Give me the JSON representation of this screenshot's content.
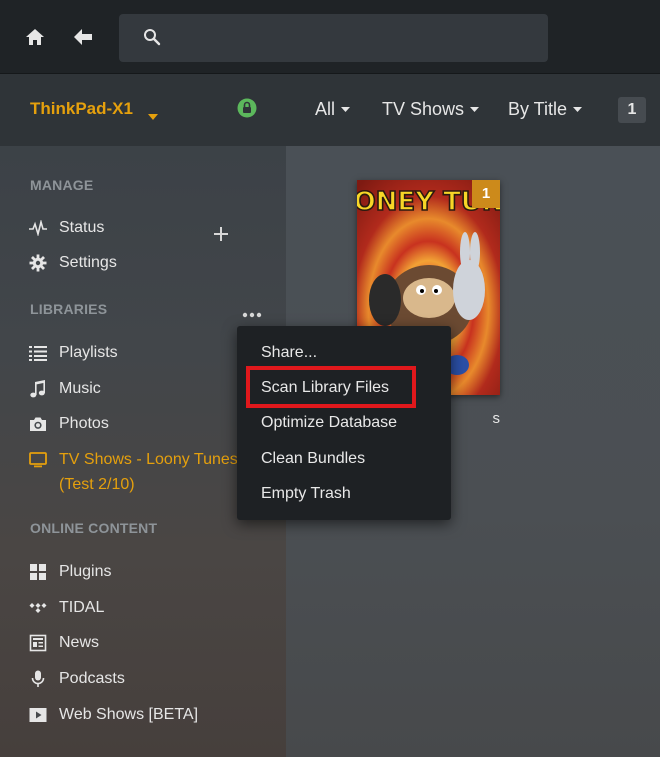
{
  "topbar": {
    "search_placeholder": ""
  },
  "server": {
    "name": "ThinkPad-X1",
    "accent_color": "#e5a00d",
    "lock_color": "#5cb85c"
  },
  "sidebar": {
    "manage_title": "MANAGE",
    "manage_items": [
      {
        "label": "Status",
        "icon": "pulse-icon"
      },
      {
        "label": "Settings",
        "icon": "gear-icon"
      }
    ],
    "libraries_title": "LIBRARIES",
    "library_items": [
      {
        "label": "Playlists",
        "icon": "list-icon"
      },
      {
        "label": "Music",
        "icon": "music-note-icon"
      },
      {
        "label": "Photos",
        "icon": "camera-icon"
      },
      {
        "label": "TV Shows - Loony Tunes",
        "sublabel": "(Test 2/10)",
        "icon": "tv-icon",
        "active": true
      }
    ],
    "online_title": "ONLINE CONTENT",
    "online_items": [
      {
        "label": "Plugins",
        "icon": "grid-icon"
      },
      {
        "label": "TIDAL",
        "icon": "tidal-icon"
      },
      {
        "label": "News",
        "icon": "newspaper-icon"
      },
      {
        "label": "Podcasts",
        "icon": "microphone-icon"
      },
      {
        "label": "Web Shows [BETA]",
        "icon": "play-icon"
      }
    ]
  },
  "content_header": {
    "filters": [
      "All",
      "TV Shows",
      "By Title"
    ],
    "count": "1"
  },
  "poster": {
    "badge": "1",
    "title_text": "LOONEY TUNES",
    "caption": "s"
  },
  "menu": {
    "items": [
      "Share...",
      "Scan Library Files",
      "Optimize Database",
      "Clean Bundles",
      "Empty Trash"
    ],
    "highlight_color": "#e0181c"
  }
}
